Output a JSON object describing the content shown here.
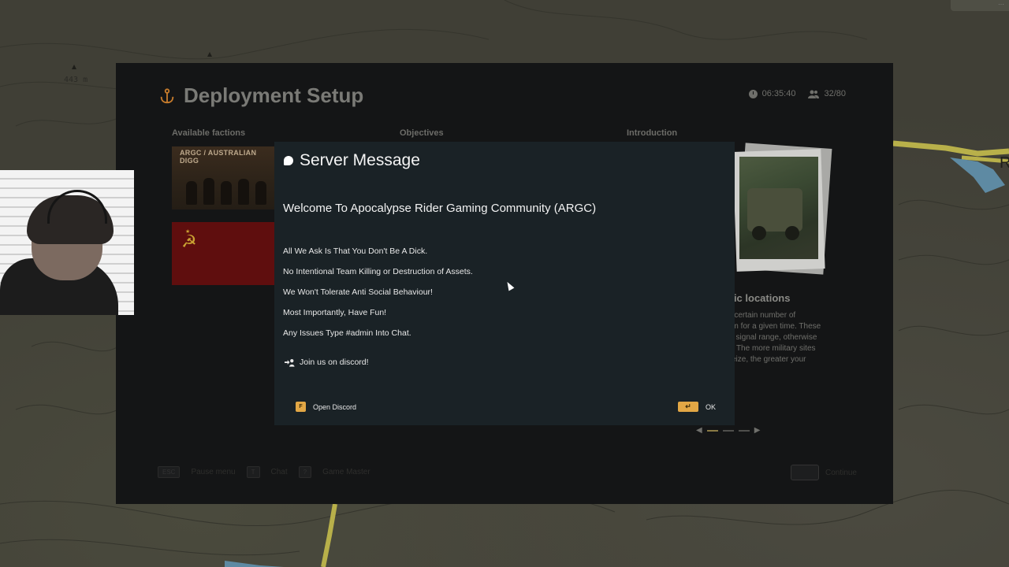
{
  "map": {
    "elevation_label": "443 m",
    "place_letter": "R"
  },
  "deployment": {
    "title": "Deployment Setup",
    "clock_time": "06:35:40",
    "player_count": "32/80",
    "columns": {
      "factions": "Available factions",
      "objectives": "Objectives",
      "introduction": "Introduction"
    },
    "factions": [
      {
        "caption": "ARGC / AUSTRALIAN DIGG",
        "colors": {
          "bg": "#3b2c1e"
        }
      },
      {
        "caption": "",
        "colors": {
          "bg": "#5f0e0e"
        }
      }
    ],
    "intro_heading": "gic locations",
    "intro_lines": [
      "e certain number of",
      "em for a given time. These",
      "io signal range, otherwise",
      "d. The more military sites",
      "seize, the greater your"
    ],
    "pager": {
      "prev": "◀",
      "next": "▶"
    },
    "bottom_bar": [
      {
        "key": "ESC",
        "label": "Pause menu"
      },
      {
        "key": "T",
        "label": "Chat"
      },
      {
        "key": "?",
        "label": "Game Master"
      }
    ],
    "continue_label": "Continue"
  },
  "modal": {
    "title": "Server Message",
    "welcome": "Welcome To Apocalypse Rider Gaming Community (ARGC)",
    "rules": [
      "All We Ask Is That You Don't Be A Dick.",
      "No Intentional Team Killing or Destruction of Assets.",
      "We Won't Tolerate Anti Social Behaviour!",
      "Most Importantly, Have Fun!",
      "Any Issues Type #admin Into Chat."
    ],
    "discord_text": "Join us on discord!",
    "open_discord_key": "F",
    "open_discord_label": "Open Discord",
    "ok_key": "↵",
    "ok_label": "OK"
  },
  "icons": {
    "title_icon": "anchor-icon",
    "clock": "clock-icon",
    "players": "players-icon",
    "message": "chat-bubble-icon",
    "discord": "add-user-icon"
  },
  "colors": {
    "accent": "#e2a745",
    "modal_bg": "#1a2226",
    "panel_bg": "#141516"
  }
}
